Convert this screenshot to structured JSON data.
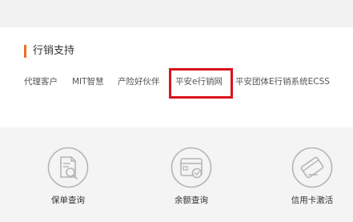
{
  "section": {
    "title": "行销支持"
  },
  "nav_links": [
    {
      "label": "代理客户"
    },
    {
      "label": "MIT智慧"
    },
    {
      "label": "产险好伙伴"
    },
    {
      "label": "平安e行销网"
    },
    {
      "label": "平安团体E行销系统ECSS"
    }
  ],
  "highlighted_link_index": 3,
  "services": [
    {
      "label": "保单查询",
      "icon": "policy-search-icon"
    },
    {
      "label": "余额查询",
      "icon": "card-balance-icon"
    },
    {
      "label": "信用卡激活",
      "icon": "card-activation-icon"
    }
  ],
  "colors": {
    "accent": "#f26b21",
    "highlight": "#d9131b",
    "icon": "#b5b5b5",
    "text": "#333333"
  }
}
